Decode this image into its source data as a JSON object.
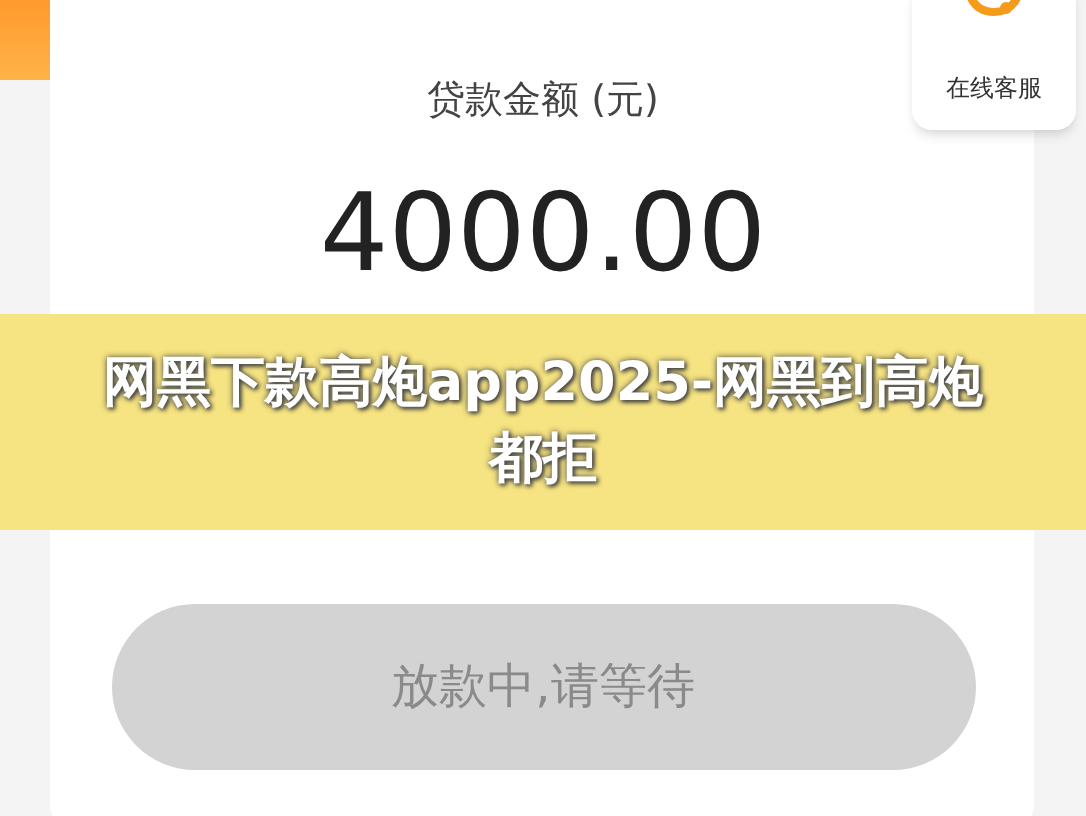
{
  "service_button": {
    "label": "在线客服"
  },
  "loan": {
    "label": "贷款金额 (元)",
    "amount": "4000.00"
  },
  "banner": {
    "title": "网黑下款高炮app2025-网黑到高炮都拒"
  },
  "status_button": {
    "label": "放款中,请等待",
    "disabled": true
  }
}
